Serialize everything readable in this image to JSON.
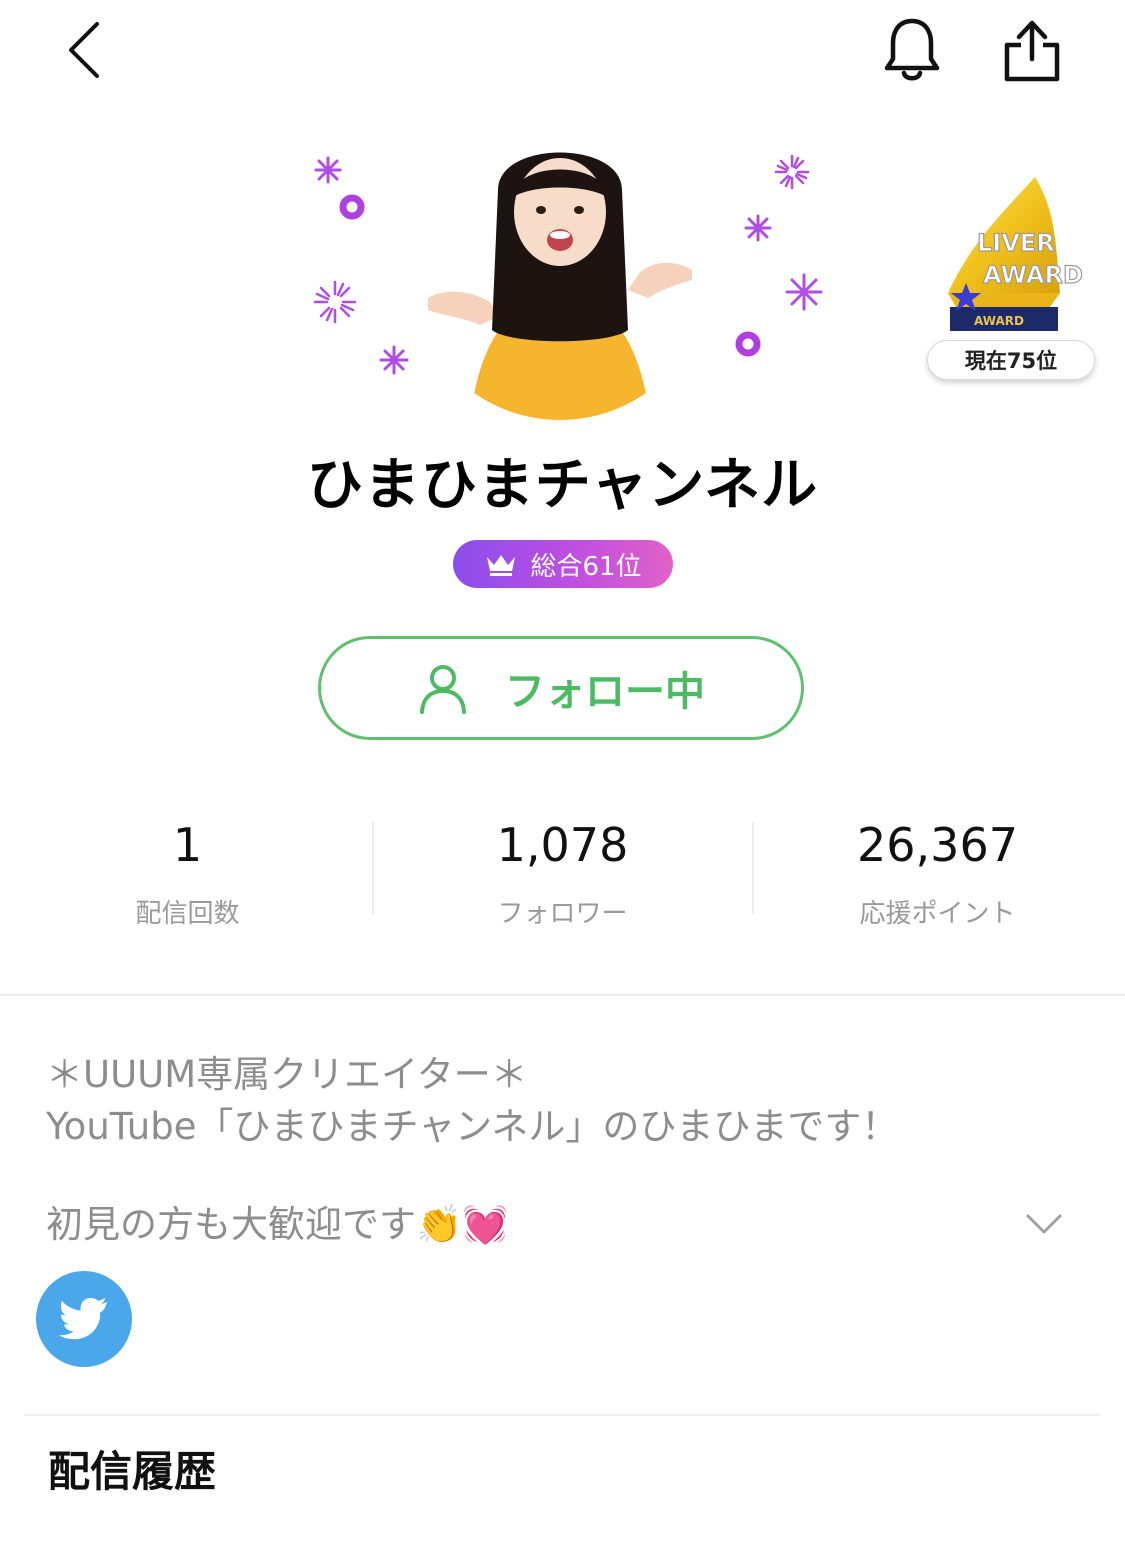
{
  "header": {
    "back_icon": "chevron-left-icon",
    "bell_icon": "bell-icon",
    "share_icon": "share-icon"
  },
  "profile": {
    "name": "ひまひまチャンネル",
    "rank_badge": "総合61位",
    "rank_icon": "crown-icon",
    "follow_label": "フォロー中",
    "follow_icon": "person-icon",
    "accent_green": "#4cbb63"
  },
  "award": {
    "line1": "LIVER",
    "line2": "AWARD",
    "plaque": "AWARD",
    "rank": "現在75位"
  },
  "stats": [
    {
      "value": "1",
      "label": "配信回数"
    },
    {
      "value": "1,078",
      "label": "フォロワー"
    },
    {
      "value": "26,367",
      "label": "応援ポイント"
    }
  ],
  "bio": {
    "line1": "＊UUUM専属クリエイター＊",
    "line2": "YouTube「ひまひまチャンネル」のひまひまです！",
    "line3": "初見の方も大歓迎です👏💓"
  },
  "social": {
    "twitter_icon": "twitter-icon"
  },
  "section": {
    "history_title": "配信履歴"
  }
}
